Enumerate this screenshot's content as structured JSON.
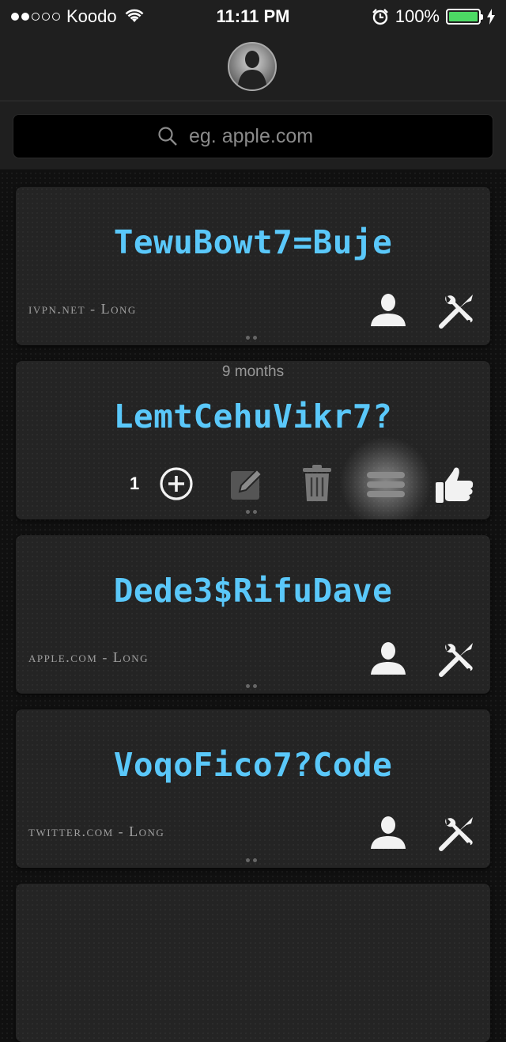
{
  "status_bar": {
    "carrier": "Koodo",
    "time": "11:11 PM",
    "battery": "100%",
    "battery_level": 1.0
  },
  "search": {
    "placeholder": "eg. apple.com"
  },
  "cards": [
    {
      "password": "TewuBowt7=Buje",
      "meta": "ivpn.net - Long"
    },
    {
      "password": "LemtCehuVikr7?",
      "age": "9 months",
      "count": "1"
    },
    {
      "password": "Dede3$RifuDave",
      "meta": "apple.com - Long"
    },
    {
      "password": "VoqoFico7?Code",
      "meta": "twitter.com - Long"
    }
  ],
  "colors": {
    "password": "#5ac8fa",
    "battery": "#4cd964"
  }
}
